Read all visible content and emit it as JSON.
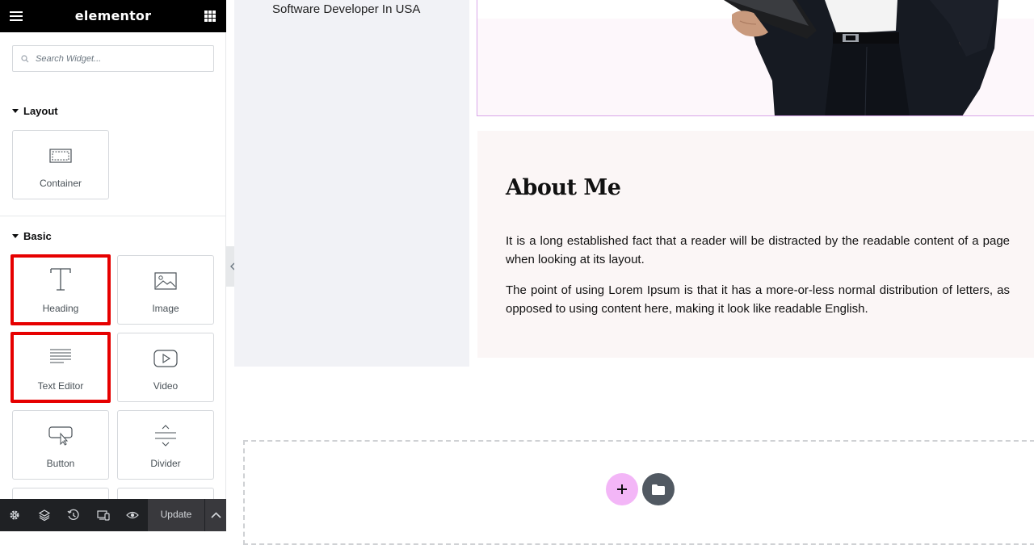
{
  "sidebar": {
    "logo": "elementor",
    "search": {
      "placeholder": "Search Widget..."
    },
    "sections": {
      "layout": {
        "title": "Layout",
        "widgets": [
          {
            "label": "Container",
            "icon": "container-icon"
          }
        ]
      },
      "basic": {
        "title": "Basic",
        "widgets": [
          {
            "label": "Heading",
            "icon": "heading-icon",
            "highlighted": true
          },
          {
            "label": "Image",
            "icon": "image-icon",
            "highlighted": false
          },
          {
            "label": "Text Editor",
            "icon": "text-editor-icon",
            "highlighted": true
          },
          {
            "label": "Video",
            "icon": "video-icon",
            "highlighted": false
          },
          {
            "label": "Button",
            "icon": "button-icon",
            "highlighted": false
          },
          {
            "label": "Divider",
            "icon": "divider-icon",
            "highlighted": false
          }
        ]
      }
    },
    "bottom_bar": {
      "icons": [
        "settings-icon",
        "layers-icon",
        "history-icon",
        "responsive-icon",
        "preview-icon"
      ],
      "update_label": "Update"
    }
  },
  "canvas": {
    "subtitle": "Software Developer In USA",
    "about": {
      "heading": "About Me",
      "paragraphs": [
        "It is a long established fact that a reader will be distracted by the readable content of a page when looking at its layout.",
        "The point of using Lorem Ipsum is that it has a more-or-less normal distribution of letters, as opposed to using content here, making it look like readable English."
      ]
    }
  },
  "colors": {
    "accent_pink": "#f3b6f7",
    "highlight_red": "#e60000",
    "topbar": "#000000",
    "bottombar": "#1f2124"
  }
}
